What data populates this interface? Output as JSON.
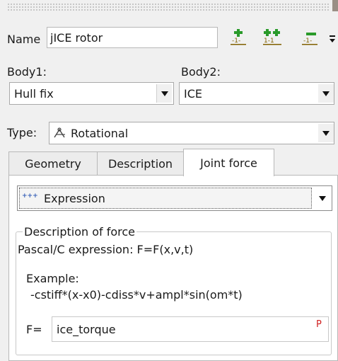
{
  "name": {
    "label": "Name",
    "value": "jICE rotor"
  },
  "toolbar": {
    "icon1": "add-icon",
    "icon2": "add-multiple-icon",
    "icon3": "remove-icon"
  },
  "body1": {
    "label": "Body1:",
    "value": "Hull fix"
  },
  "body2": {
    "label": "Body2:",
    "value": "ICE"
  },
  "type": {
    "label": "Type:",
    "icon": "rotational-icon",
    "value": "Rotational"
  },
  "tabs": [
    {
      "label": "Geometry",
      "active": false
    },
    {
      "label": "Description",
      "active": false
    },
    {
      "label": "Joint force",
      "active": true
    }
  ],
  "force_type": {
    "icon": "expression-icon",
    "icon_text": "+++",
    "value": "Expression"
  },
  "group": {
    "title": "Description of force",
    "formula": "Pascal/C expression: F=F(x,v,t)",
    "example_label": "Example:",
    "example_text": "-cstiff*(x-x0)-cdiss*v+ampl*sin(om*t)"
  },
  "f_field": {
    "label": "F=",
    "value": "ice_torque",
    "badge": "P"
  }
}
